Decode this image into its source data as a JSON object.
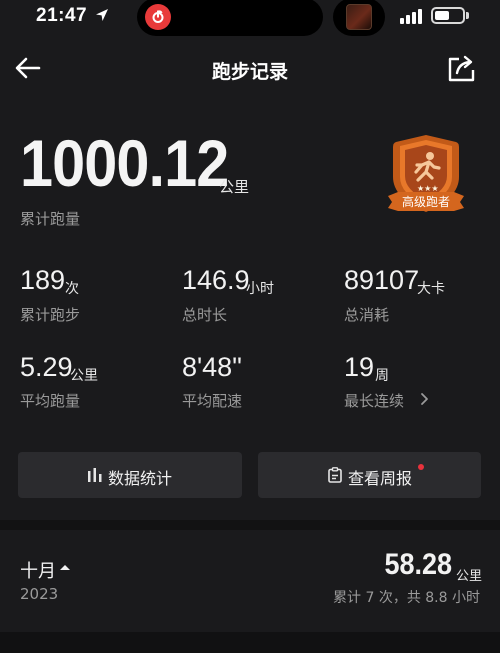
{
  "status_bar": {
    "time": "21:47",
    "battery_percent": 55
  },
  "nav": {
    "title": "跑步记录"
  },
  "total": {
    "value": "1000.12",
    "unit": "公里",
    "label": "累计跑量"
  },
  "badge": {
    "label": "高级跑者",
    "stars": 3,
    "color": "#e8782a"
  },
  "stats": [
    {
      "value": "189",
      "unit": "次",
      "label": "累计跑步"
    },
    {
      "value": "146.9",
      "unit": "小时",
      "label": "总时长"
    },
    {
      "value": "89107",
      "unit": "大卡",
      "label": "总消耗"
    },
    {
      "value": "5.29",
      "unit": "公里",
      "label": "平均跑量"
    },
    {
      "value": "8'48\"",
      "unit": "",
      "label": "平均配速"
    },
    {
      "value": "19",
      "unit": "周",
      "label": "最长连续"
    }
  ],
  "buttons": {
    "data_stats": "数据统计",
    "weekly_report": "查看周报"
  },
  "month": {
    "label": "十月",
    "year": "2023",
    "value": "58.28",
    "unit": "公里",
    "summary": "累计 7 次，共 8.8 小时"
  },
  "colors": {
    "background": "#1a1a1c",
    "button": "#2b2b2e",
    "notification_dot": "#e8323c",
    "app_icon": "#e83a3a"
  }
}
